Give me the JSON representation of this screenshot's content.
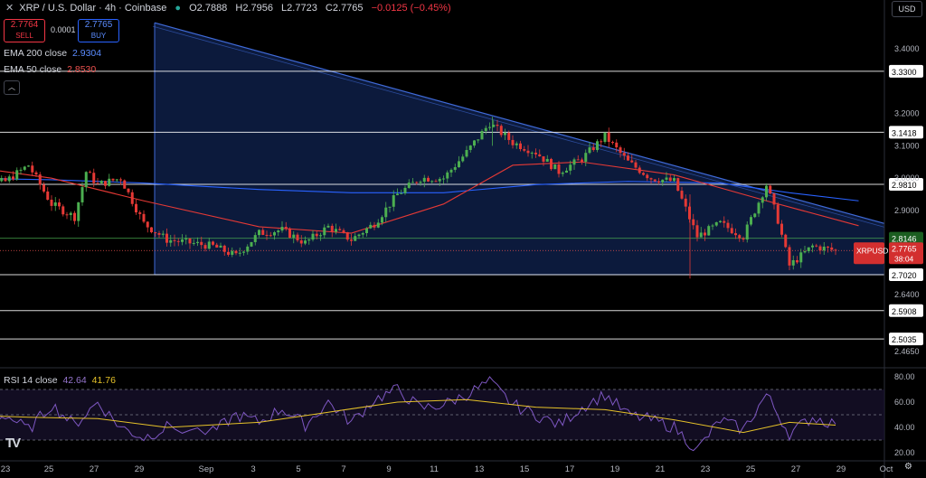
{
  "header": {
    "title": "XRP / U.S. Dollar · 4h · Coinbase",
    "o_label": "O",
    "o": "2.7888",
    "h_label": "H",
    "h": "2.7956",
    "l_label": "L",
    "l": "2.7723",
    "c_label": "C",
    "c": "2.7765",
    "change": "−0.0125 (−0.45%)"
  },
  "trade": {
    "sell_price": "2.7764",
    "sell_label": "SELL",
    "spread": "0.0001",
    "buy_price": "2.7765",
    "buy_label": "BUY"
  },
  "indicators": {
    "ema200_label": "EMA 200 close",
    "ema200_value": "2.9304",
    "ema50_label": "EMA 50 close",
    "ema50_value": "2.8530",
    "rsi_label": "RSI 14 close",
    "rsi_value": "42.64",
    "rsi_ma_value": "41.76"
  },
  "currency_button": "USD",
  "symbol_tag": {
    "symbol": "XRPUSD",
    "price": "2.7765",
    "countdown": "38:04"
  },
  "colors": {
    "up": "#26a69a",
    "down": "#ef5350",
    "up_candle": "#4caf50",
    "down_candle": "#e53935",
    "ema200": "#2962ff",
    "ema50": "#e53935",
    "rsi": "#7e57c2",
    "rsi_ma": "#e6c229",
    "triangle_fill": "#0e1f47",
    "triangle_line": "#3f6ad8",
    "level_line": "#ffffff",
    "support_line": "#4caf50"
  },
  "chart_data": [
    {
      "type": "candlestick",
      "title": "XRP / U.S. Dollar · 4h · Coinbase",
      "price_axis_ticks": [
        "3.4000",
        "3.2000",
        "3.1000",
        "3.0000",
        "2.9000",
        "2.6400",
        "2.4650"
      ],
      "date_axis_ticks": [
        "23",
        "25",
        "27",
        "29",
        "Sep",
        "3",
        "5",
        "7",
        "9",
        "11",
        "13",
        "15",
        "17",
        "19",
        "21",
        "23",
        "25",
        "27",
        "29",
        "Oct"
      ],
      "ylim": [
        2.42,
        3.5
      ],
      "horizontal_levels": [
        3.33,
        3.1418,
        2.981,
        2.8146,
        2.702,
        2.5908,
        2.5035
      ],
      "level_labels": [
        "3.3300",
        "3.1418",
        "2.9810",
        "2.8146",
        "2.7020",
        "2.5908",
        "2.5035"
      ],
      "triangle_pattern": {
        "top_left": [
          "Aug 29",
          3.48
        ],
        "upper_end": [
          "Sep 30",
          2.86
        ],
        "base_level": 2.702,
        "base_start": "Aug 29"
      },
      "price_path_keypoints": [
        [
          "Aug 21",
          3.02
        ],
        [
          "Aug 22",
          2.98
        ],
        [
          "Aug 23",
          2.99
        ],
        [
          "Aug 24",
          3.04
        ],
        [
          "Aug 25",
          2.92
        ],
        [
          "Aug 26",
          2.88
        ],
        [
          "Aug 26",
          3.02
        ],
        [
          "Aug 27",
          2.98
        ],
        [
          "Aug 28",
          3.0
        ],
        [
          "Aug 29",
          2.86
        ],
        [
          "Aug 30",
          2.81
        ],
        [
          "Sep 1",
          2.79
        ],
        [
          "Sep 2",
          2.76
        ],
        [
          "Sep 3",
          2.83
        ],
        [
          "Sep 4",
          2.84
        ],
        [
          "Sep 5",
          2.8
        ],
        [
          "Sep 6",
          2.85
        ],
        [
          "Sep 7",
          2.81
        ],
        [
          "Sep 8",
          2.86
        ],
        [
          "Sep 9",
          2.95
        ],
        [
          "Sep 10",
          3.0
        ],
        [
          "Sep 11",
          3.0
        ],
        [
          "Sep 12",
          3.08
        ],
        [
          "Sep 13",
          3.17
        ],
        [
          "Sep 14",
          3.11
        ],
        [
          "Sep 15",
          3.08
        ],
        [
          "Sep 16",
          3.02
        ],
        [
          "Sep 17",
          3.06
        ],
        [
          "Sep 18",
          3.13
        ],
        [
          "Sep 19",
          3.05
        ],
        [
          "Sep 20",
          3.0
        ],
        [
          "Sep 21",
          2.99
        ],
        [
          "Sep 22",
          2.82
        ],
        [
          "Sep 23",
          2.86
        ],
        [
          "Sep 24",
          2.82
        ],
        [
          "Sep 25",
          2.98
        ],
        [
          "Sep 25",
          2.87
        ],
        [
          "Sep 26",
          2.73
        ],
        [
          "Sep 27",
          2.79
        ],
        [
          "Sep 28",
          2.7765
        ]
      ],
      "series": [
        {
          "name": "EMA 200 close",
          "last": 2.9304,
          "values": [
            [
              "Aug 21",
              3.0
            ],
            [
              "Aug 25",
              2.995
            ],
            [
              "Aug 29",
              2.985
            ],
            [
              "Sep 3",
              2.965
            ],
            [
              "Sep 7",
              2.955
            ],
            [
              "Sep 11",
              2.955
            ],
            [
              "Sep 15",
              2.98
            ],
            [
              "Sep 19",
              2.99
            ],
            [
              "Sep 23",
              2.985
            ],
            [
              "Sep 26",
              2.955
            ],
            [
              "Sep 29",
              2.93
            ]
          ]
        },
        {
          "name": "EMA 50 close",
          "last": 2.853,
          "values": [
            [
              "Aug 21",
              3.04
            ],
            [
              "Aug 25",
              3.0
            ],
            [
              "Aug 29",
              2.93
            ],
            [
              "Sep 3",
              2.85
            ],
            [
              "Sep 7",
              2.83
            ],
            [
              "Sep 11",
              2.92
            ],
            [
              "Sep 14",
              3.04
            ],
            [
              "Sep 17",
              3.05
            ],
            [
              "Sep 21",
              3.01
            ],
            [
              "Sep 25",
              2.93
            ],
            [
              "Sep 29",
              2.853
            ]
          ]
        }
      ]
    },
    {
      "type": "line",
      "title": "RSI 14 close",
      "ylim": [
        15,
        85
      ],
      "y_ticks": [
        80,
        60,
        40,
        20
      ],
      "bands": [
        70,
        50,
        30
      ],
      "series": [
        {
          "name": "RSI",
          "last": 42.64,
          "values": [
            [
              "Aug 21",
              55
            ],
            [
              "Aug 22",
              42
            ],
            [
              "Aug 23",
              50
            ],
            [
              "Aug 24",
              38
            ],
            [
              "Aug 25",
              58
            ],
            [
              "Aug 26",
              42
            ],
            [
              "Aug 27",
              60
            ],
            [
              "Aug 28",
              40
            ],
            [
              "Aug 29",
              32
            ],
            [
              "Aug 30",
              40
            ],
            [
              "Sep 1",
              36
            ],
            [
              "Sep 2",
              50
            ],
            [
              "Sep 3",
              44
            ],
            [
              "Sep 4",
              55
            ],
            [
              "Sep 5",
              42
            ],
            [
              "Sep 6",
              60
            ],
            [
              "Sep 7",
              44
            ],
            [
              "Sep 8",
              62
            ],
            [
              "Sep 9",
              70
            ],
            [
              "Sep 10",
              55
            ],
            [
              "Sep 11",
              58
            ],
            [
              "Sep 12",
              66
            ],
            [
              "Sep 13",
              76
            ],
            [
              "Sep 14",
              58
            ],
            [
              "Sep 15",
              50
            ],
            [
              "Sep 16",
              42
            ],
            [
              "Sep 17",
              56
            ],
            [
              "Sep 18",
              66
            ],
            [
              "Sep 19",
              50
            ],
            [
              "Sep 20",
              46
            ],
            [
              "Sep 21",
              40
            ],
            [
              "Sep 22",
              22
            ],
            [
              "Sep 23",
              46
            ],
            [
              "Sep 24",
              38
            ],
            [
              "Sep 25",
              66
            ],
            [
              "Sep 26",
              35
            ],
            [
              "Sep 27",
              48
            ],
            [
              "Sep 28",
              42.64
            ]
          ]
        },
        {
          "name": "RSI MA",
          "last": 41.76,
          "values": [
            [
              "Aug 21",
              50
            ],
            [
              "Aug 24",
              48
            ],
            [
              "Aug 27",
              47
            ],
            [
              "Aug 30",
              40
            ],
            [
              "Sep 3",
              44
            ],
            [
              "Sep 6",
              52
            ],
            [
              "Sep 9",
              60
            ],
            [
              "Sep 12",
              62
            ],
            [
              "Sep 15",
              56
            ],
            [
              "Sep 18",
              54
            ],
            [
              "Sep 21",
              46
            ],
            [
              "Sep 24",
              36
            ],
            [
              "Sep 26",
              44
            ],
            [
              "Sep 28",
              41.76
            ]
          ]
        }
      ]
    }
  ]
}
